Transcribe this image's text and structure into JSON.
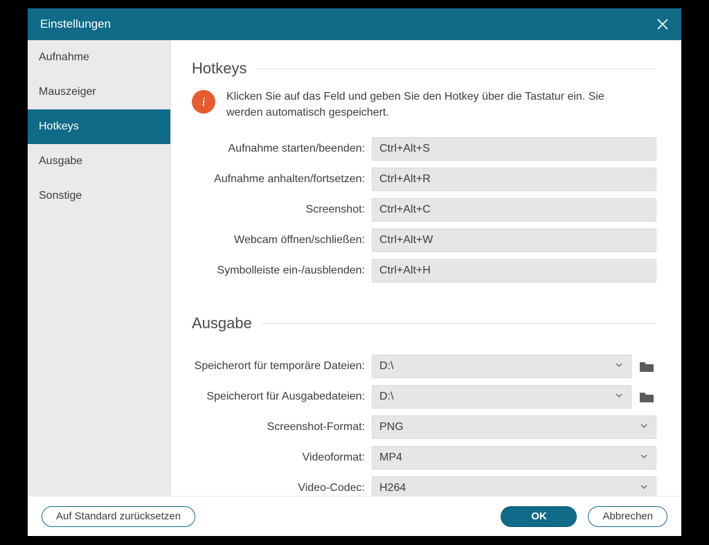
{
  "window": {
    "title": "Einstellungen"
  },
  "sidebar": {
    "items": [
      {
        "label": "Aufnahme",
        "active": false
      },
      {
        "label": "Mauszeiger",
        "active": false
      },
      {
        "label": "Hotkeys",
        "active": true
      },
      {
        "label": "Ausgabe",
        "active": false
      },
      {
        "label": "Sonstige",
        "active": false
      }
    ]
  },
  "sections": {
    "hotkeys": {
      "title": "Hotkeys",
      "tip": "Klicken Sie auf das Feld und geben Sie den Hotkey über die Tastatur ein. Sie werden automatisch gespeichert.",
      "rows": [
        {
          "label": "Aufnahme starten/beenden:",
          "value": "Ctrl+Alt+S"
        },
        {
          "label": "Aufnahme anhalten/fortsetzen:",
          "value": "Ctrl+Alt+R"
        },
        {
          "label": "Screenshot:",
          "value": "Ctrl+Alt+C"
        },
        {
          "label": "Webcam öffnen/schließen:",
          "value": "Ctrl+Alt+W"
        },
        {
          "label": "Symbolleiste ein-/ausblenden:",
          "value": "Ctrl+Alt+H"
        }
      ]
    },
    "output": {
      "title": "Ausgabe",
      "rows": [
        {
          "label": "Speicherort für temporäre Dateien:",
          "value": "D:\\",
          "kind": "path"
        },
        {
          "label": "Speicherort für Ausgabedateien:",
          "value": "D:\\",
          "kind": "path"
        },
        {
          "label": "Screenshot-Format:",
          "value": "PNG",
          "kind": "select"
        },
        {
          "label": "Videoformat:",
          "value": "MP4",
          "kind": "select"
        },
        {
          "label": "Video-Codec:",
          "value": "H264",
          "kind": "select"
        }
      ]
    }
  },
  "footer": {
    "reset": "Auf Standard zurücksetzen",
    "ok": "OK",
    "cancel": "Abbrechen"
  },
  "icons": {
    "info_badge": "i"
  }
}
